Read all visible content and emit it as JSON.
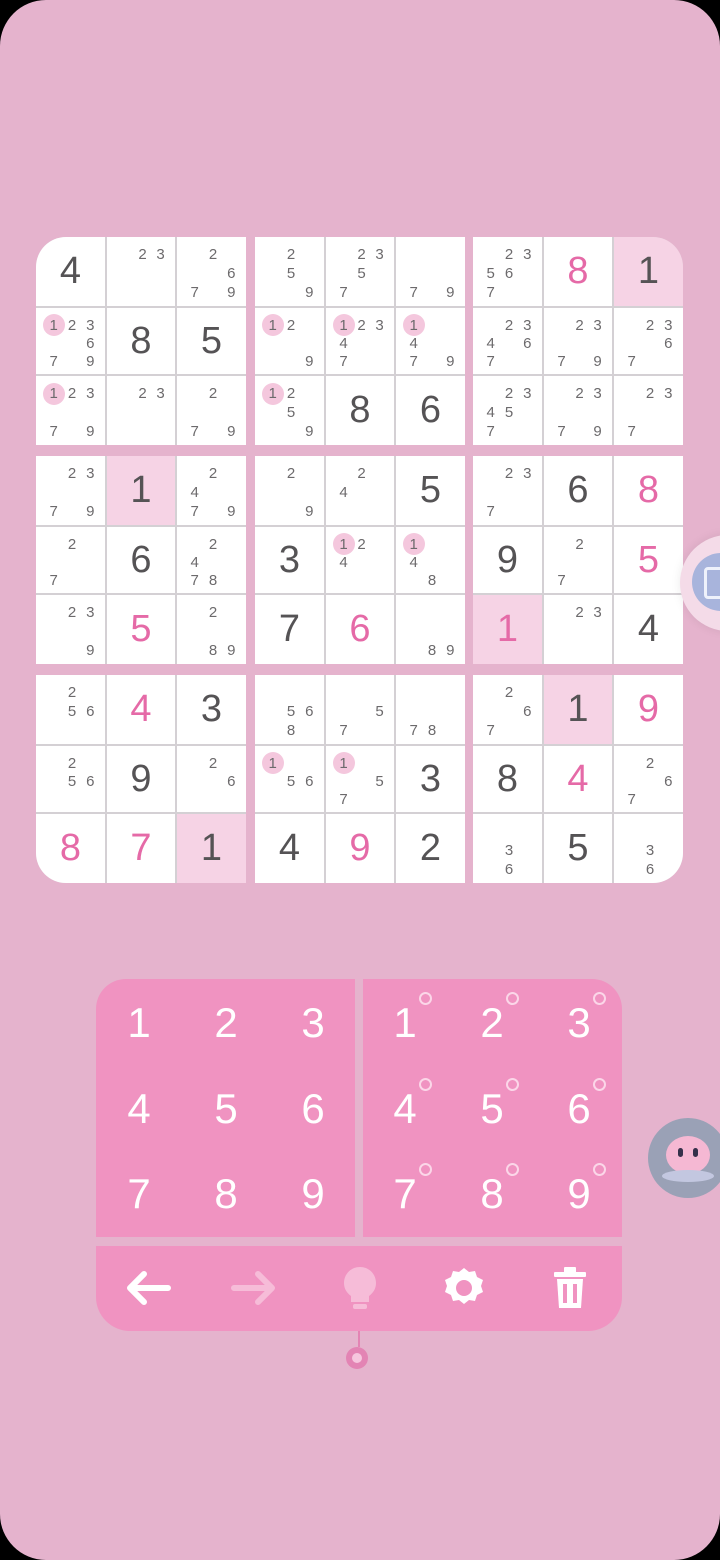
{
  "board": {
    "cells": [
      [
        {
          "v": "4"
        },
        {
          "n": [
            "",
            "2",
            "3",
            "",
            "",
            "",
            "",
            "",
            ""
          ]
        },
        {
          "n": [
            "",
            "2",
            "",
            "",
            "",
            "6",
            "7",
            "",
            "9"
          ]
        },
        {
          "n": [
            "",
            "2",
            "",
            "",
            "5",
            "",
            "",
            "",
            "9"
          ]
        },
        {
          "n": [
            "",
            "2",
            "3",
            "",
            "5",
            "",
            "7",
            "",
            ""
          ]
        },
        {
          "n": [
            "",
            "",
            "",
            "",
            "",
            "",
            "7",
            "",
            "9"
          ]
        },
        {
          "n": [
            "",
            "2",
            "3",
            "5",
            "6",
            "",
            "7",
            "",
            ""
          ]
        },
        {
          "v": "8",
          "user": true
        },
        {
          "v": "1",
          "hl": true
        }
      ],
      [
        {
          "n": [
            "1",
            "2",
            "3",
            "",
            "",
            "6",
            "7",
            "",
            "9"
          ],
          "m": 0
        },
        {
          "v": "8"
        },
        {
          "v": "5"
        },
        {
          "n": [
            "1",
            "2",
            "",
            "",
            "",
            "",
            "",
            "",
            "9"
          ],
          "m": 0
        },
        {
          "n": [
            "1",
            "2",
            "3",
            "4",
            "",
            "",
            "7",
            "",
            ""
          ],
          "m": 0
        },
        {
          "n": [
            "1",
            "",
            "",
            "4",
            "",
            "",
            "7",
            "",
            "9"
          ],
          "m": 0
        },
        {
          "n": [
            "",
            "2",
            "3",
            "4",
            "",
            "6",
            "7",
            "",
            ""
          ]
        },
        {
          "n": [
            "",
            "2",
            "3",
            "",
            "",
            "",
            "7",
            "",
            "9"
          ]
        },
        {
          "n": [
            "",
            "2",
            "3",
            "",
            "",
            "6",
            "7",
            "",
            ""
          ]
        }
      ],
      [
        {
          "n": [
            "1",
            "2",
            "3",
            "",
            "",
            "",
            "7",
            "",
            "9"
          ],
          "m": 0
        },
        {
          "n": [
            "",
            "2",
            "3",
            "",
            "",
            "",
            "",
            "",
            ""
          ]
        },
        {
          "n": [
            "",
            "2",
            "",
            "",
            "",
            "",
            "7",
            "",
            "9"
          ]
        },
        {
          "n": [
            "1",
            "2",
            "",
            "",
            "5",
            "",
            "",
            "",
            "9"
          ],
          "m": 0
        },
        {
          "v": "8"
        },
        {
          "v": "6"
        },
        {
          "n": [
            "",
            "2",
            "3",
            "4",
            "5",
            "",
            "7",
            "",
            ""
          ]
        },
        {
          "n": [
            "",
            "2",
            "3",
            "",
            "",
            "",
            "7",
            "",
            "9"
          ]
        },
        {
          "n": [
            "",
            "2",
            "3",
            "",
            "",
            "",
            "7",
            "",
            ""
          ]
        }
      ],
      [
        {
          "n": [
            "",
            "2",
            "3",
            "",
            "",
            "",
            "7",
            "",
            "9"
          ]
        },
        {
          "v": "1",
          "hl": true
        },
        {
          "n": [
            "",
            "2",
            "",
            "4",
            "",
            "",
            "7",
            "",
            "9"
          ]
        },
        {
          "n": [
            "",
            "2",
            "",
            "",
            "",
            "",
            "",
            "",
            "9"
          ]
        },
        {
          "n": [
            "",
            "2",
            "",
            "4",
            "",
            "",
            "",
            "",
            ""
          ]
        },
        {
          "v": "5"
        },
        {
          "n": [
            "",
            "2",
            "3",
            "",
            "",
            "",
            "7",
            "",
            ""
          ]
        },
        {
          "v": "6"
        },
        {
          "v": "8",
          "user": true
        }
      ],
      [
        {
          "n": [
            "",
            "2",
            "",
            "",
            "",
            "",
            "7",
            "",
            ""
          ]
        },
        {
          "v": "6"
        },
        {
          "n": [
            "",
            "2",
            "",
            "4",
            "",
            "",
            "7",
            "8",
            ""
          ]
        },
        {
          "v": "3"
        },
        {
          "n": [
            "1",
            "2",
            "",
            "4",
            "",
            "",
            "",
            "",
            ""
          ],
          "m": 0
        },
        {
          "n": [
            "1",
            "",
            "",
            "4",
            "",
            "",
            "",
            "8",
            ""
          ],
          "m": 0
        },
        {
          "v": "9"
        },
        {
          "n": [
            "",
            "2",
            "",
            "",
            "",
            "",
            "7",
            "",
            ""
          ]
        },
        {
          "v": "5",
          "user": true
        }
      ],
      [
        {
          "n": [
            "",
            "2",
            "3",
            "",
            "",
            "",
            "",
            "",
            "9"
          ]
        },
        {
          "v": "5",
          "user": true
        },
        {
          "n": [
            "",
            "2",
            "",
            "",
            "",
            "",
            "",
            "8",
            "9"
          ]
        },
        {
          "v": "7"
        },
        {
          "v": "6",
          "user": true
        },
        {
          "n": [
            "",
            "",
            "",
            "",
            "",
            "",
            "",
            "8",
            "9"
          ]
        },
        {
          "v": "1",
          "user": true,
          "hl": true
        },
        {
          "n": [
            "",
            "2",
            "3",
            "",
            "",
            "",
            "",
            "",
            ""
          ]
        },
        {
          "v": "4"
        }
      ],
      [
        {
          "n": [
            "",
            "2",
            "",
            "",
            "5",
            "6",
            "",
            "",
            ""
          ]
        },
        {
          "v": "4",
          "user": true
        },
        {
          "v": "3"
        },
        {
          "n": [
            "",
            "",
            "",
            "",
            "5",
            "6",
            "",
            "8",
            ""
          ]
        },
        {
          "n": [
            "",
            "",
            "",
            "",
            "",
            "5",
            "7",
            "",
            ""
          ]
        },
        {
          "n": [
            "",
            "",
            "",
            "",
            "",
            "",
            "7",
            "8",
            ""
          ]
        },
        {
          "n": [
            "",
            "2",
            "",
            "",
            "",
            "6",
            "7",
            "",
            ""
          ]
        },
        {
          "v": "1",
          "hl": true
        },
        {
          "v": "9",
          "user": true
        }
      ],
      [
        {
          "n": [
            "",
            "2",
            "",
            "",
            "5",
            "6",
            "",
            "",
            ""
          ]
        },
        {
          "v": "9"
        },
        {
          "n": [
            "",
            "2",
            "",
            "",
            "",
            "6",
            "",
            "",
            ""
          ]
        },
        {
          "n": [
            "1",
            "",
            "",
            "",
            "5",
            "6",
            "",
            "",
            ""
          ],
          "m": 0
        },
        {
          "n": [
            "1",
            "",
            "",
            "",
            "",
            "5",
            "7",
            "",
            ""
          ],
          "m": 0
        },
        {
          "v": "3"
        },
        {
          "v": "8"
        },
        {
          "v": "4",
          "user": true
        },
        {
          "n": [
            "",
            "2",
            "",
            "",
            "",
            "6",
            "7",
            "",
            ""
          ]
        }
      ],
      [
        {
          "v": "8",
          "user": true
        },
        {
          "v": "7",
          "user": true
        },
        {
          "v": "1",
          "hl": true
        },
        {
          "v": "4"
        },
        {
          "v": "9",
          "user": true
        },
        {
          "v": "2"
        },
        {
          "n": [
            "",
            "",
            "",
            "",
            "3",
            "",
            "",
            "6",
            ""
          ]
        },
        {
          "v": "5"
        },
        {
          "n": [
            "",
            "",
            "",
            "",
            "3",
            "",
            "",
            "6",
            ""
          ]
        }
      ]
    ]
  },
  "pad": {
    "numbers": [
      "1",
      "2",
      "3",
      "4",
      "5",
      "6",
      "7",
      "8",
      "9"
    ],
    "note_numbers": [
      "1",
      "2",
      "3",
      "4",
      "5",
      "6",
      "7",
      "8",
      "9"
    ]
  },
  "toolbar": {
    "icons": [
      "undo-arrow-icon",
      "redo-arrow-icon",
      "hint-bulb-icon",
      "settings-gear-icon",
      "delete-trash-icon"
    ]
  },
  "colors": {
    "background": "#e5b3cd",
    "pad": "#f093c1",
    "user_digit": "#e56aa7",
    "given_digit": "#555355",
    "highlight": "#f6d3e5"
  }
}
